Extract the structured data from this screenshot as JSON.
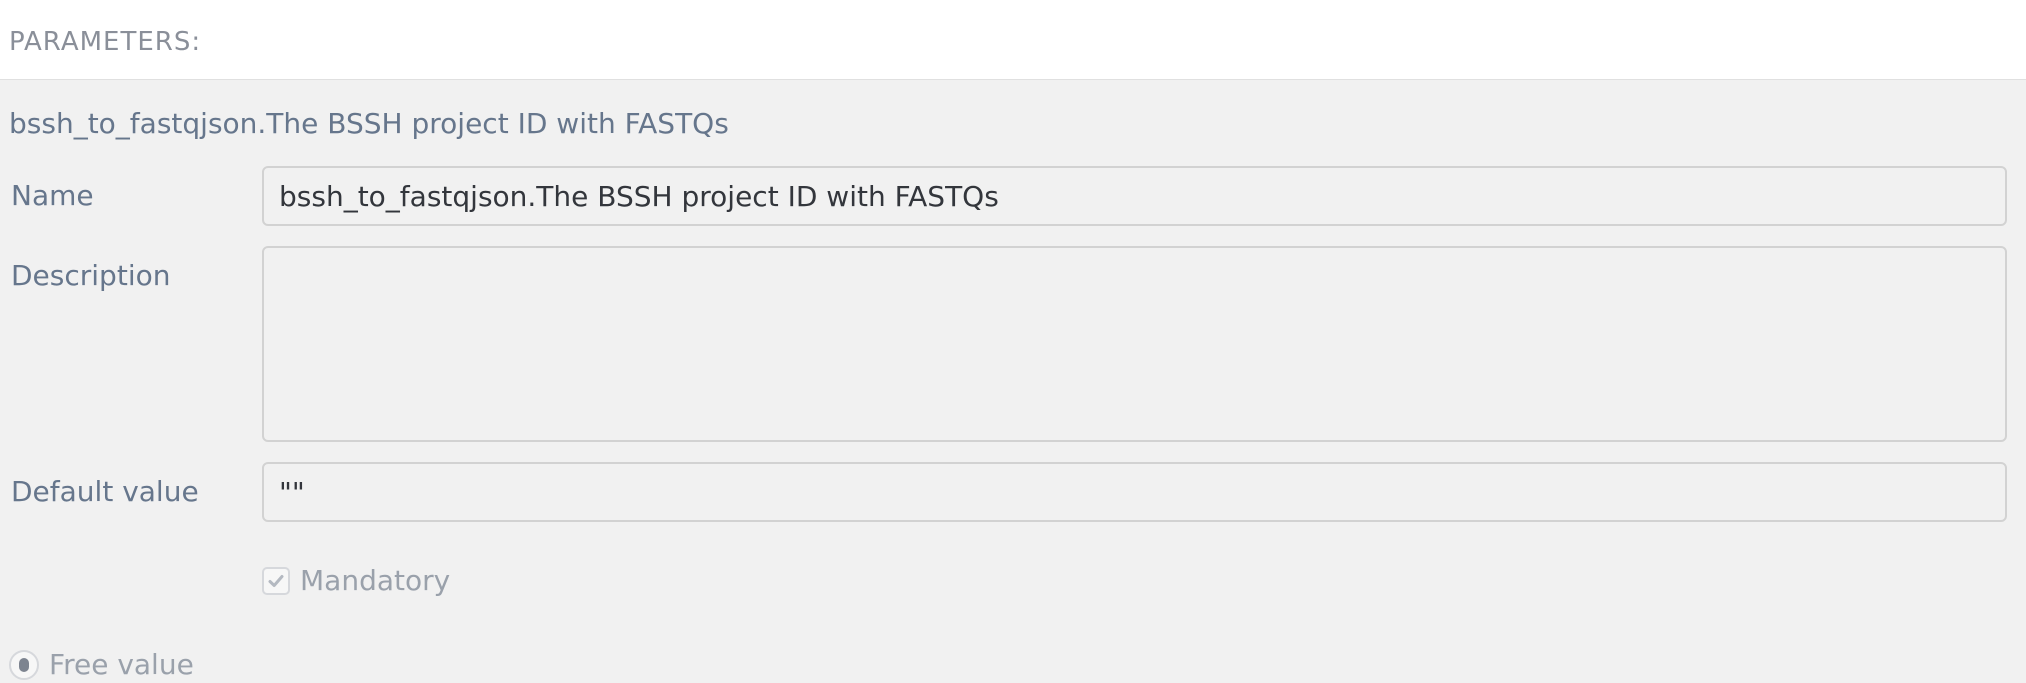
{
  "header": {
    "title": "PARAMETERS:"
  },
  "parameter": {
    "heading": "bssh_to_fastqjson.The BSSH project ID with FASTQs",
    "name_label": "Name",
    "name_value": "bssh_to_fastqjson.The BSSH project ID with FASTQs",
    "description_label": "Description",
    "description_value": "",
    "default_label": "Default value",
    "default_value": "\"\"",
    "mandatory_label": "Mandatory",
    "mandatory_checked": true,
    "free_value_label": "Free value",
    "free_value_selected": true
  },
  "colors": {
    "label": "#66768c",
    "muted": "#9aa1ab",
    "background": "#f1f1f1",
    "field_border": "#d2d2d2"
  }
}
